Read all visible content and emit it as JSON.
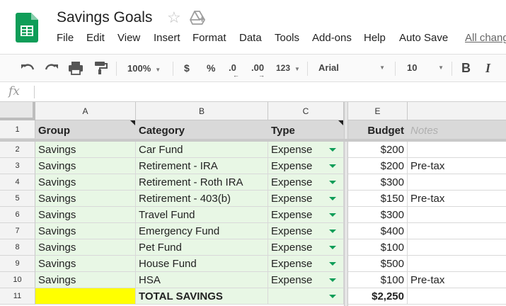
{
  "app": {
    "title": "Savings Goals",
    "all_changes": "All changes"
  },
  "menu": [
    "File",
    "Edit",
    "View",
    "Insert",
    "Format",
    "Data",
    "Tools",
    "Add-ons",
    "Help",
    "Auto Save"
  ],
  "toolbar": {
    "zoom": "100%",
    "currency": "$",
    "percent": "%",
    "dec_less": ".0",
    "dec_more": ".00",
    "more_formats": "123",
    "font": "Arial",
    "font_size": "10",
    "bold": "B",
    "italic": "I"
  },
  "formula_bar": {
    "fx": "fx",
    "value": ""
  },
  "columns": [
    "A",
    "B",
    "C",
    "E"
  ],
  "header_row": {
    "row_number": "1",
    "group": "Group",
    "category": "Category",
    "type": "Type",
    "budget": "Budget",
    "notes": "Notes"
  },
  "rows": [
    {
      "n": "2",
      "group": "Savings",
      "category": "Car Fund",
      "type": "Expense",
      "budget": "$200",
      "notes": ""
    },
    {
      "n": "3",
      "group": "Savings",
      "category": "Retirement - IRA",
      "type": "Expense",
      "budget": "$200",
      "notes": "Pre-tax"
    },
    {
      "n": "4",
      "group": "Savings",
      "category": "Retirement - Roth IRA",
      "type": "Expense",
      "budget": "$300",
      "notes": ""
    },
    {
      "n": "5",
      "group": "Savings",
      "category": "Retirement - 403(b)",
      "type": "Expense",
      "budget": "$150",
      "notes": "Pre-tax"
    },
    {
      "n": "6",
      "group": "Savings",
      "category": "Travel Fund",
      "type": "Expense",
      "budget": "$300",
      "notes": ""
    },
    {
      "n": "7",
      "group": "Savings",
      "category": "Emergency Fund",
      "type": "Expense",
      "budget": "$400",
      "notes": ""
    },
    {
      "n": "8",
      "group": "Savings",
      "category": "Pet Fund",
      "type": "Expense",
      "budget": "$100",
      "notes": ""
    },
    {
      "n": "9",
      "group": "Savings",
      "category": "House Fund",
      "type": "Expense",
      "budget": "$500",
      "notes": ""
    },
    {
      "n": "10",
      "group": "Savings",
      "category": "HSA",
      "type": "Expense",
      "budget": "$100",
      "notes": "Pre-tax"
    }
  ],
  "total_row": {
    "n": "11",
    "label": "TOTAL SAVINGS",
    "budget": "$2,250"
  },
  "colors": {
    "green_fill": "#e8f7e5",
    "yellow_fill": "#ffff00",
    "sheets_green": "#0f9d58"
  }
}
